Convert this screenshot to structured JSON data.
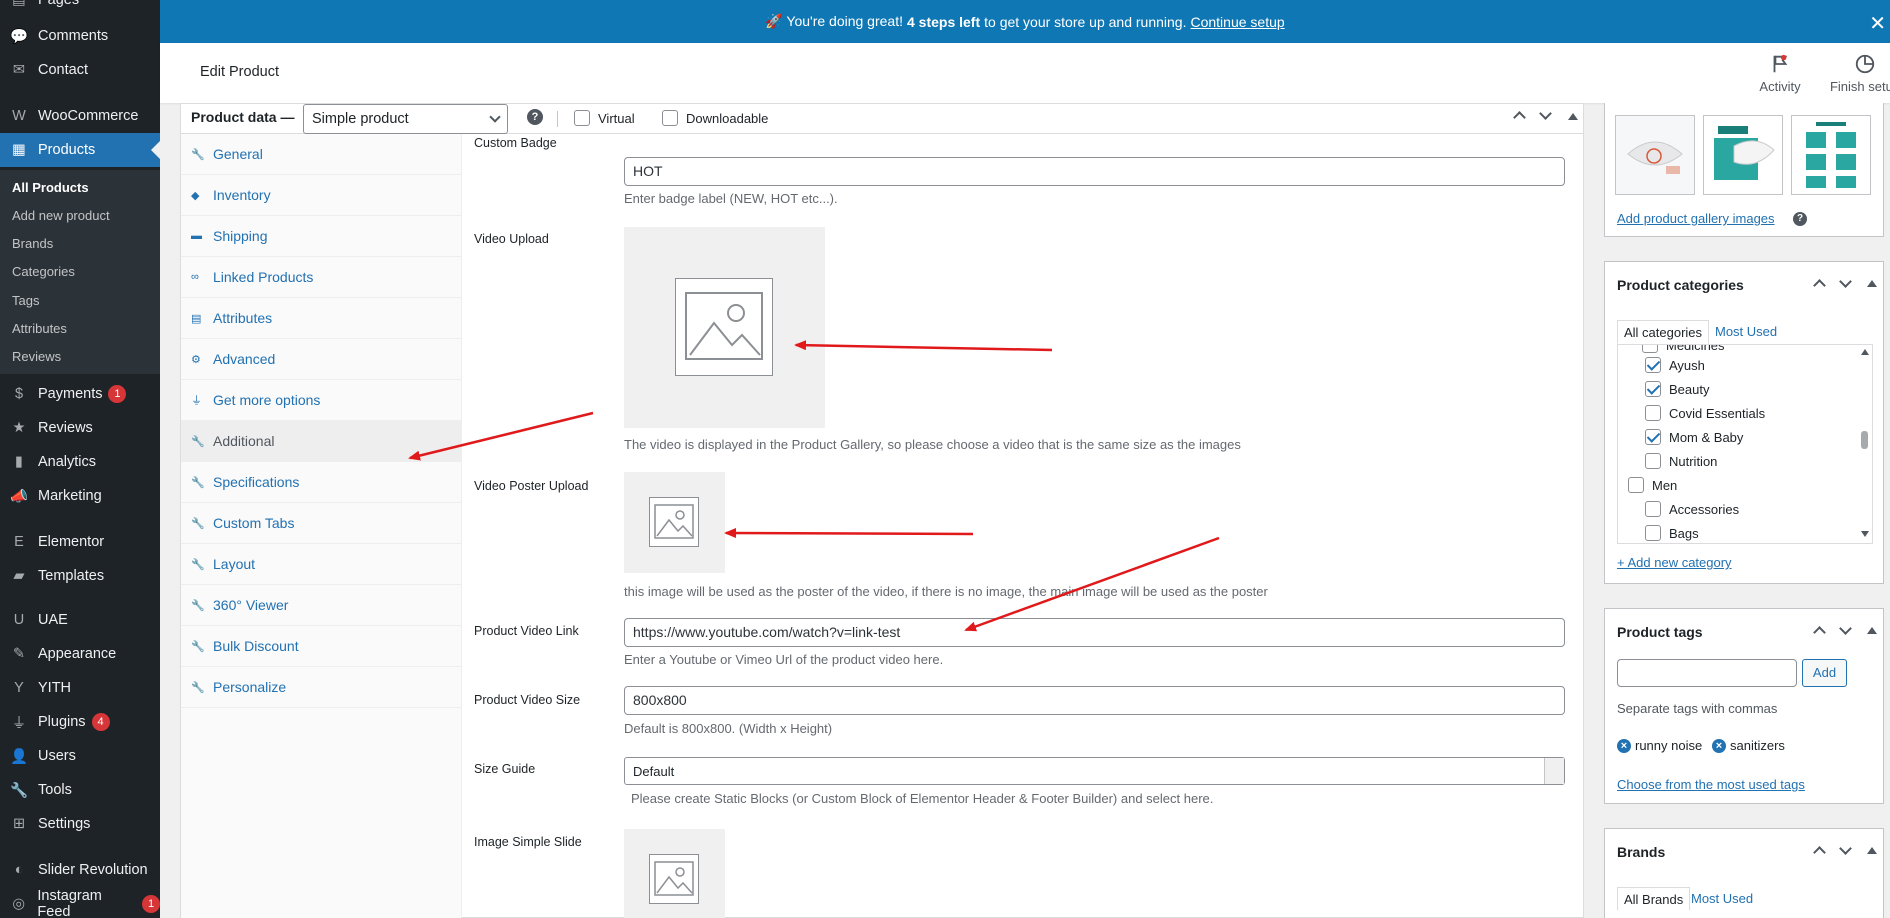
{
  "sidebar": {
    "items": [
      {
        "label": "Pages",
        "icon": "pages-icon"
      },
      {
        "label": "Comments",
        "icon": "comment-icon"
      },
      {
        "label": "Contact",
        "icon": "mail-icon"
      },
      {
        "label": "WooCommerce",
        "icon": "woocommerce-icon"
      },
      {
        "label": "Products",
        "icon": "archive-icon"
      },
      {
        "label": "Payments",
        "icon": "dollar-icon",
        "badge": "1"
      },
      {
        "label": "Reviews",
        "icon": "star-icon"
      },
      {
        "label": "Analytics",
        "icon": "bar-chart-icon"
      },
      {
        "label": "Marketing",
        "icon": "megaphone-icon"
      },
      {
        "label": "Elementor",
        "icon": "elementor-icon"
      },
      {
        "label": "Templates",
        "icon": "folder-icon"
      },
      {
        "label": "UAE",
        "icon": "uae-icon"
      },
      {
        "label": "Appearance",
        "icon": "paintbrush-icon"
      },
      {
        "label": "YITH",
        "icon": "yith-icon"
      },
      {
        "label": "Plugins",
        "icon": "plug-icon",
        "badge": "4"
      },
      {
        "label": "Users",
        "icon": "user-icon"
      },
      {
        "label": "Tools",
        "icon": "wrench-icon"
      },
      {
        "label": "Settings",
        "icon": "settings-icon"
      },
      {
        "label": "Slider Revolution",
        "icon": "slider-revolution-icon"
      },
      {
        "label": "Instagram Feed",
        "icon": "instagram-icon",
        "badge": "1"
      }
    ],
    "submenu": [
      "All Products",
      "Add new product",
      "Brands",
      "Categories",
      "Tags",
      "Attributes",
      "Reviews"
    ]
  },
  "banner": {
    "prefix": "🚀 You're doing great!",
    "bold": "4 steps left",
    "middle": "to get your store up and running.",
    "link": "Continue setup",
    "close": "✕"
  },
  "header": {
    "title": "Edit Product",
    "activity": "Activity",
    "finish_setup": "Finish setup"
  },
  "product_data": {
    "title": "Product data —",
    "type": "Simple product",
    "help": "?",
    "virtual": "Virtual",
    "downloadable": "Downloadable",
    "tabs": [
      {
        "label": "General",
        "icon": "wrench-icon"
      },
      {
        "label": "Inventory",
        "icon": "tag-icon"
      },
      {
        "label": "Shipping",
        "icon": "truck-icon"
      },
      {
        "label": "Linked Products",
        "icon": "link-icon"
      },
      {
        "label": "Attributes",
        "icon": "list-icon"
      },
      {
        "label": "Advanced",
        "icon": "gear-icon"
      },
      {
        "label": "Get more options",
        "icon": "plugin-icon"
      },
      {
        "label": "Additional",
        "icon": "wrench-icon"
      },
      {
        "label": "Specifications",
        "icon": "wrench-icon"
      },
      {
        "label": "Custom Tabs",
        "icon": "wrench-icon"
      },
      {
        "label": "Layout",
        "icon": "wrench-icon"
      },
      {
        "label": "360° Viewer",
        "icon": "wrench-icon"
      },
      {
        "label": "Bulk Discount",
        "icon": "wrench-icon"
      },
      {
        "label": "Personalize",
        "icon": "wrench-icon"
      }
    ],
    "fields": {
      "custom_badge": {
        "label": "Custom Badge",
        "value": "HOT",
        "desc": "Enter badge label (NEW, HOT etc...)."
      },
      "video_upload": {
        "label": "Video Upload",
        "desc": "The video is displayed in the Product Gallery, so please choose a video that is the same size as the images"
      },
      "video_poster": {
        "label": "Video Poster Upload",
        "desc": "this image will be used as the poster of the video, if there is no image, the main image will be used as the poster"
      },
      "video_link": {
        "label": "Product Video Link",
        "value": "https://www.youtube.com/watch?v=link-test",
        "desc": "Enter a Youtube or Vimeo Url of the product video here."
      },
      "video_size": {
        "label": "Product Video Size",
        "value": "800x800",
        "desc": "Default is 800x800. (Width x Height)"
      },
      "size_guide": {
        "label": "Size Guide",
        "value": "Default",
        "desc": "Please create Static Blocks (or Custom Block of Elementor Header & Footer Builder) and select here."
      },
      "image_slide": {
        "label": "Image Simple Slide"
      }
    }
  },
  "gallery": {
    "link": "Add product gallery images"
  },
  "categories": {
    "title": "Product categories",
    "tab_all": "All categories",
    "tab_most": "Most Used",
    "partial": "Medicines",
    "items": [
      {
        "label": "Ayush",
        "checked": true,
        "level": 1
      },
      {
        "label": "Beauty",
        "checked": true,
        "level": 1
      },
      {
        "label": "Covid Essentials",
        "checked": false,
        "level": 1
      },
      {
        "label": "Mom & Baby",
        "checked": true,
        "level": 1
      },
      {
        "label": "Nutrition",
        "checked": false,
        "level": 1
      },
      {
        "label": "Men",
        "checked": false,
        "level": 0
      },
      {
        "label": "Accessories",
        "checked": false,
        "level": 1
      },
      {
        "label": "Bags",
        "checked": false,
        "level": 1
      }
    ],
    "add_new": "+ Add new category"
  },
  "tags": {
    "title": "Product tags",
    "add_button": "Add",
    "hint": "Separate tags with commas",
    "items": [
      "runny noise",
      "sanitizers"
    ],
    "choose_link": "Choose from the most used tags"
  },
  "brands": {
    "title": "Brands",
    "tab_all": "All Brands",
    "tab_most": "Most Used"
  },
  "colors": {
    "sidebar_bg": "#1d2327",
    "accent": "#2271b1",
    "banner": "#0f77b4",
    "annotation": "#e0191b"
  }
}
